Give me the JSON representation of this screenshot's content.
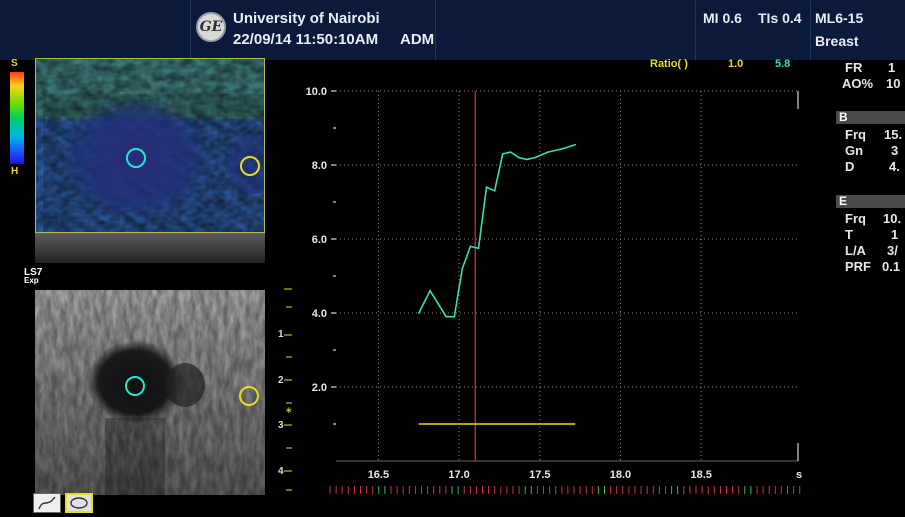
{
  "header": {
    "institution": "University of Nairobi",
    "datetime": "22/09/14 11:50:10AM",
    "operator": "ADM",
    "mi": "MI 0.6",
    "tis": "TIs 0.4",
    "probe": "ML6-15",
    "preset": "Breast",
    "logo_text": "GE"
  },
  "side_panel": {
    "fr_label": "FR",
    "fr_value": "1",
    "ao_label": "AO%",
    "ao_value": "10",
    "b_section": "B",
    "b_frq_label": "Frq",
    "b_frq_value": "15.",
    "b_gn_label": "Gn",
    "b_gn_value": "3",
    "b_d_label": "D",
    "b_d_value": "4.",
    "e_section": "E",
    "e_frq_label": "Frq",
    "e_frq_value": "10.",
    "e_t_label": "T",
    "e_t_value": "1",
    "e_la_label": "L/A",
    "e_la_value": "3/",
    "e_prf_label": "PRF",
    "e_prf_value": "0.1"
  },
  "ratio_bar": {
    "label": "Ratio( )",
    "value1": "1.0",
    "value2": "5.8"
  },
  "colorbar": {
    "top_label": "S",
    "bottom_label": "H"
  },
  "image_labels": {
    "mode": "LS7",
    "sub": "Exp"
  },
  "depth_scale": {
    "labels": [
      "1",
      "2",
      "3",
      "4"
    ]
  },
  "colors": {
    "curve": "#33e0b0",
    "cursor": "#e03030",
    "baseline": "#e6d820",
    "marker_cyan": "#22e6d0",
    "marker_yellow": "#e8dc20"
  },
  "chart_data": {
    "type": "line",
    "xlabel": "s",
    "ylabel": "",
    "xlim": [
      16.2,
      19.1
    ],
    "ylim": [
      0,
      10.0
    ],
    "x_ticks": [
      "16.5",
      "17.0",
      "17.5",
      "18.0",
      "18.5"
    ],
    "y_ticks": [
      "2.0",
      "4.0",
      "6.0",
      "8.0",
      "10.0"
    ],
    "grid": true,
    "cursor_x": 17.1,
    "series": [
      {
        "x": [
          16.75,
          16.82,
          16.92,
          16.97,
          17.02,
          17.07,
          17.12,
          17.17,
          17.22,
          17.27,
          17.32,
          17.37,
          17.42,
          17.47,
          17.55,
          17.65,
          17.72
        ],
        "y": [
          4.0,
          4.6,
          3.9,
          3.9,
          5.2,
          5.8,
          5.75,
          7.4,
          7.3,
          8.3,
          8.35,
          8.2,
          8.15,
          8.2,
          8.35,
          8.45,
          8.55
        ]
      }
    ],
    "baseline": {
      "x": [
        16.75,
        17.72
      ],
      "y": 1.0
    }
  }
}
